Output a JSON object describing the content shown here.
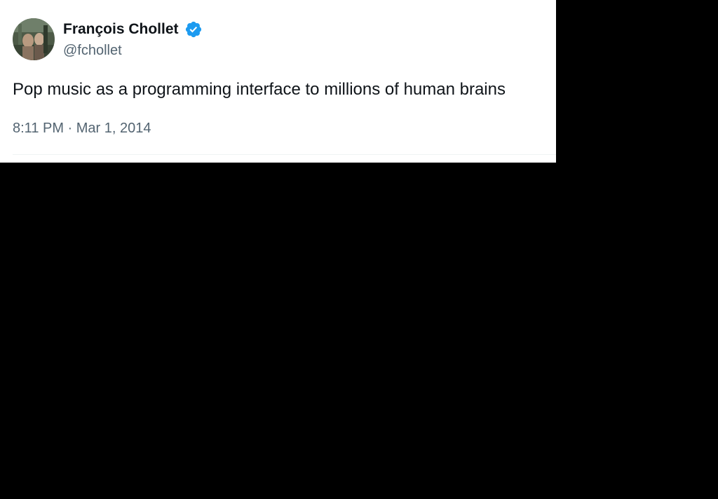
{
  "tweet": {
    "author": {
      "display_name": "François Chollet",
      "handle": "@fchollet",
      "verified": true,
      "avatar_icon": "profile-photo"
    },
    "text": "Pop music as a programming interface to millions of human brains",
    "timestamp": "8:11 PM · Mar 1, 2014"
  },
  "colors": {
    "card_background": "#ffffff",
    "page_background": "#000000",
    "primary_text": "#0f1419",
    "secondary_text": "#536471",
    "verified_badge": "#1d9bf0"
  }
}
